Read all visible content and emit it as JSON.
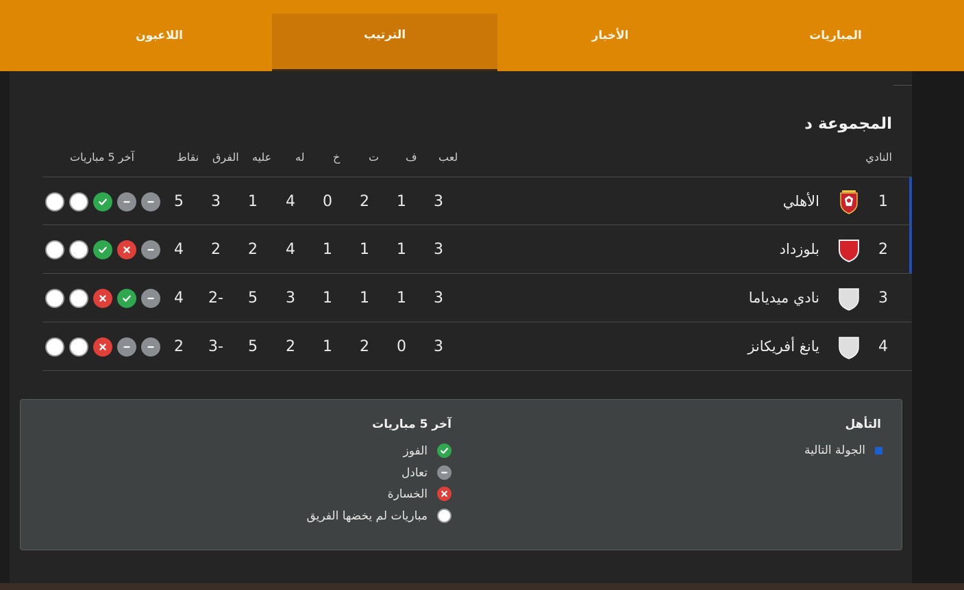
{
  "tabs": [
    {
      "label": "المباريات",
      "active": false
    },
    {
      "label": "الأخبار",
      "active": false
    },
    {
      "label": "الترتيب",
      "active": true
    },
    {
      "label": "اللاعبون",
      "active": false
    }
  ],
  "group_title": "المجموعة د",
  "headers": {
    "club": "النادي",
    "played": "لعب",
    "won": "ف",
    "drawn": "ت",
    "lost": "خ",
    "gf": "له",
    "ga": "عليه",
    "gd": "الفرق",
    "pts": "نقاط",
    "form": "آخر 5 مباريات"
  },
  "rows": [
    {
      "pos": "1",
      "team": "الأهلي",
      "crest": "al-ahly-crest",
      "played": "3",
      "won": "1",
      "drawn": "2",
      "lost": "0",
      "gf": "4",
      "ga": "1",
      "gd": "3",
      "pts": "5",
      "qualified": true,
      "form": [
        "none",
        "none",
        "win",
        "draw",
        "draw"
      ]
    },
    {
      "pos": "2",
      "team": "بلوزداد",
      "crest": "red-shield-crest",
      "played": "3",
      "won": "1",
      "drawn": "1",
      "lost": "1",
      "gf": "4",
      "ga": "2",
      "gd": "2",
      "pts": "4",
      "qualified": true,
      "form": [
        "none",
        "none",
        "win",
        "loss",
        "draw"
      ]
    },
    {
      "pos": "3",
      "team": "نادي ميدياما",
      "crest": "white-shield-crest",
      "played": "3",
      "won": "1",
      "drawn": "1",
      "lost": "1",
      "gf": "3",
      "ga": "5",
      "gd": "-2",
      "pts": "4",
      "qualified": false,
      "form": [
        "none",
        "none",
        "loss",
        "win",
        "draw"
      ]
    },
    {
      "pos": "4",
      "team": "يانغ أفريكانز",
      "crest": "white-shield-crest",
      "played": "3",
      "won": "0",
      "drawn": "2",
      "lost": "1",
      "gf": "2",
      "ga": "5",
      "gd": "-3",
      "pts": "2",
      "qualified": false,
      "form": [
        "none",
        "none",
        "loss",
        "draw",
        "draw"
      ]
    }
  ],
  "legend": {
    "qual_title": "التأهل",
    "qual_item": "الجولة التالية",
    "form_title": "آخر 5 مباريات",
    "win": "الفوز",
    "draw": "تعادل",
    "loss": "الخسارة",
    "none": "مباريات لم يخضها الفريق"
  },
  "colors": {
    "accent": "#de8704",
    "win": "#2fa84f",
    "draw": "#8a8e92",
    "loss": "#e0403a",
    "qualified": "#1d4fb8"
  }
}
